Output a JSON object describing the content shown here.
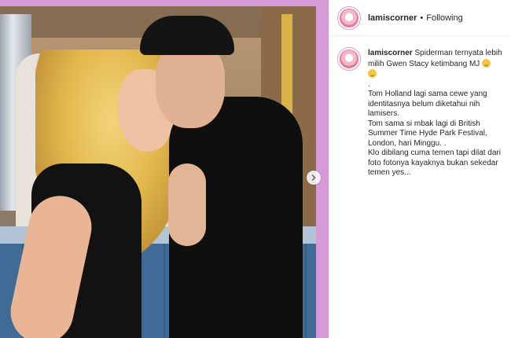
{
  "post": {
    "username": "lamiscorner",
    "separator": "•",
    "follow_state": "Following",
    "next_icon": "chevron-right-icon"
  },
  "caption": {
    "username": "lamiscorner",
    "line1": "Spiderman ternyata lebih milih Gwen Stacy ketimbang MJ",
    "period": ".",
    "para1": "Tom Holland lagi sama cewe yang identitasnya belum diketahui nih lamisers.",
    "para2": "Tom sama si mbak lagi di British Summer Time Hyde Park Festival, London, hari Minggu. .",
    "para3": "Klo dibilang cuma temen tapi dilat dari foto fotonya kayaknya bukan sekedar temen yes...",
    "emoji_name": "grinning-face-emoji"
  },
  "colors": {
    "frame_accent": "#d79ad9",
    "text": "#262626"
  }
}
